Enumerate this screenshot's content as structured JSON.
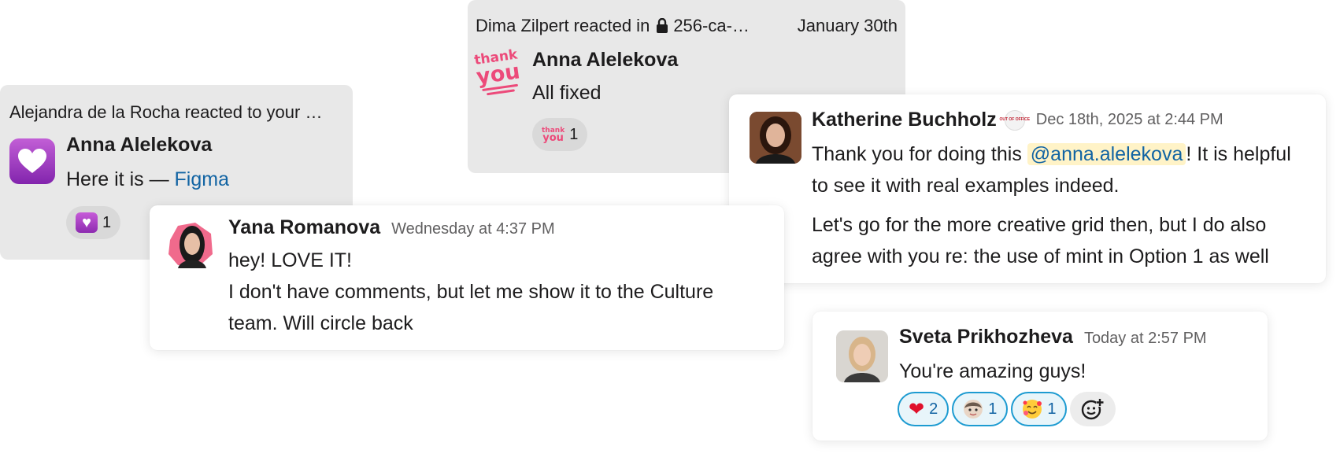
{
  "cards": {
    "alejandra": {
      "header": "Alejandra de la Rocha reacted to your …",
      "author": "Anna Alelekova",
      "message_prefix": "Here it is — ",
      "link_text": "Figma",
      "reaction": {
        "icon": "purple-heart-icon",
        "glyph": "♥",
        "count": "1"
      }
    },
    "dima": {
      "header_prefix": "Dima Zilpert reacted in",
      "channel": "256-ca-…",
      "date": "January 30th",
      "author": "Anna Alelekova",
      "message": "All fixed",
      "reaction": {
        "icon": "thank-you-sticker-icon",
        "count": "1"
      },
      "sticker_top": "thank",
      "sticker_bottom": "you"
    },
    "katherine": {
      "author": "Katherine Buchholz",
      "status_icon": "out-of-office-icon",
      "status_text": "OUT OF OFFICE",
      "time": "Dec 18th, 2025 at 2:44 PM",
      "p1_before": "Thank you for doing this ",
      "mention": "@anna.alelekova",
      "p1_after": "! It is helpful",
      "p1_line2": "to see it with real examples indeed.",
      "p2_line1": "Let's go for the more creative grid then, but I do also",
      "p2_line2": "agree with you re: the use of mint in Option 1 as well"
    },
    "yana": {
      "author": "Yana Romanova",
      "time": "Wednesday at 4:37 PM",
      "line1": "hey! LOVE IT!",
      "line2": "I don't have comments, but let me show it to the Culture",
      "line3": "team. Will circle back"
    },
    "sveta": {
      "author": "Sveta Prikhozheva",
      "time": "Today at 2:57 PM",
      "message": "You're amazing guys!",
      "reactions": [
        {
          "icon": "red-heart-icon",
          "glyph": "❤",
          "count": "2"
        },
        {
          "icon": "custom-face-emoji-icon",
          "count": "1"
        },
        {
          "icon": "smiling-face-with-hearts-icon",
          "glyph": "🥰",
          "count": "1"
        }
      ]
    }
  },
  "colors": {
    "link": "#1264a3",
    "mention_bg": "#fff3c7",
    "gray_card": "#e8e8e8",
    "reaction_active_border": "#1d9bd1",
    "thank_you_pink": "#ec4a7a"
  }
}
